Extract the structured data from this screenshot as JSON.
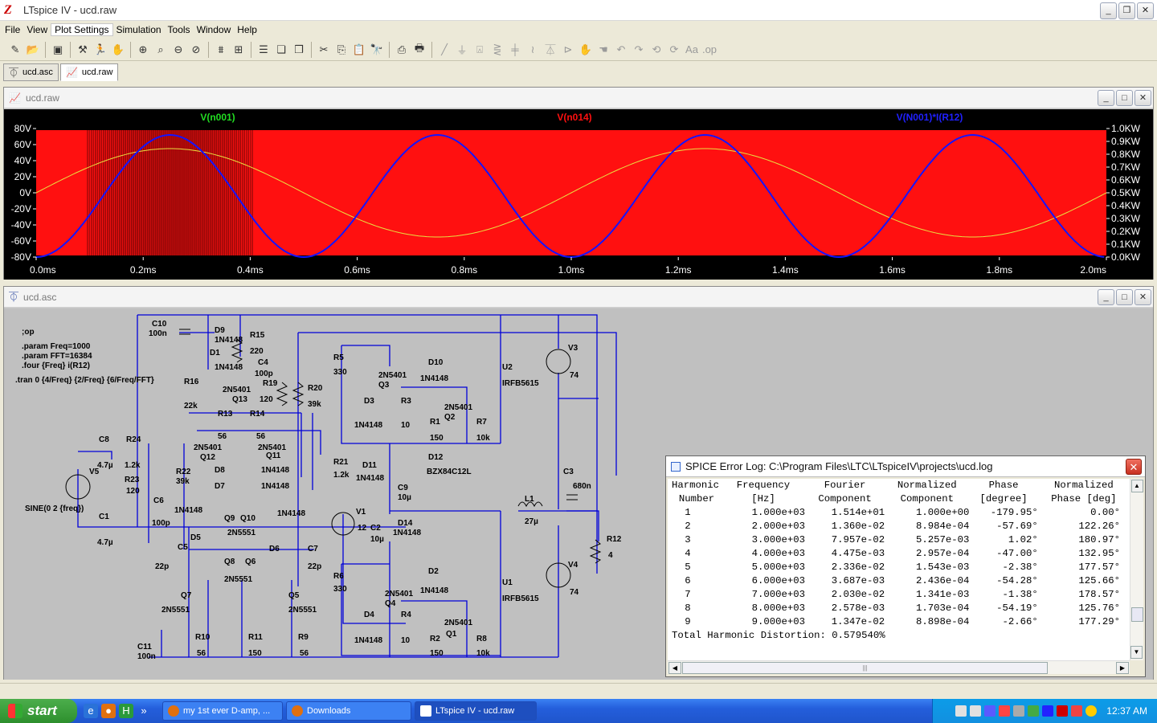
{
  "window": {
    "title": "LTspice IV - ucd.raw"
  },
  "menu": [
    "File",
    "View",
    "Plot Settings",
    "Simulation",
    "Tools",
    "Window",
    "Help"
  ],
  "tabs": [
    {
      "label": "ucd.asc"
    },
    {
      "label": "ucd.raw"
    }
  ],
  "plot_window": {
    "title": "ucd.raw",
    "traces": [
      {
        "label": "V(n001)",
        "color": "#22dd22"
      },
      {
        "label": "V(n014)",
        "color": "#ff1010"
      },
      {
        "label": "V(N001)*I(R12)",
        "color": "#2020ff"
      }
    ]
  },
  "chart_data": {
    "type": "line",
    "x": [
      0.0,
      0.25,
      0.5,
      0.75,
      1.0,
      1.25,
      1.5,
      1.75,
      2.0
    ],
    "series": [
      {
        "name": "V(n001)",
        "values": [
          0,
          55,
          0,
          -55,
          0,
          55,
          0,
          -55,
          0
        ]
      },
      {
        "name": "V(N001)*I(R12)",
        "values": [
          0,
          0.95,
          0,
          0.95,
          0,
          0.95,
          0,
          0.95,
          0
        ]
      }
    ],
    "xlim": [
      0,
      2.0
    ],
    "ylim_left": [
      -80,
      80
    ],
    "ylim_right": [
      0,
      1.0
    ],
    "xticks": [
      "0.0ms",
      "0.2ms",
      "0.4ms",
      "0.6ms",
      "0.8ms",
      "1.0ms",
      "1.2ms",
      "1.4ms",
      "1.6ms",
      "1.8ms",
      "2.0ms"
    ],
    "yticks_left": [
      "80V",
      "60V",
      "40V",
      "20V",
      "0V",
      "-20V",
      "-40V",
      "-60V",
      "-80V"
    ],
    "yticks_right": [
      "1.0KW",
      "0.9KW",
      "0.8KW",
      "0.7KW",
      "0.6KW",
      "0.5KW",
      "0.4KW",
      "0.3KW",
      "0.2KW",
      "0.1KW",
      "0.0KW"
    ]
  },
  "schematic_window": {
    "title": "ucd.asc",
    "directives": [
      ";op",
      ".param Freq=1000",
      ".param FFT=16384",
      ".four {Freq} i(R12)",
      ".tran 0 {4/Freq} {2/Freq} {6/Freq/FFT}"
    ],
    "labels": {
      "C10": "C10",
      "c10v": "100n",
      "D9": "D9",
      "d9v": "1N4148",
      "R15": "R15",
      "r15v": "220",
      "D1": "D1",
      "d1v": "1N4148",
      "C4": "C4",
      "c4v": "100p",
      "R19": "R19",
      "r19v": "120",
      "R20": "R20",
      "r20v": "39k",
      "R16": "R16",
      "r16v": "22k",
      "Q13": "Q13",
      "q13v": "2N5401",
      "R13": "R13",
      "r13v": "56",
      "R14": "R14",
      "r14v": "56",
      "Q12": "Q12",
      "q12v": "2N5401",
      "Q11": "Q11",
      "q11v": "2N5401",
      "C8": "C8",
      "c8v": "4.7µ",
      "R24": "R24",
      "r24v": "1.2k",
      "V5": "V5",
      "v5v": "SINE(0 2 {freq})",
      "R23": "R23",
      "r23v": "120",
      "R22": "R22",
      "r22v": "39k",
      "C6": "C6",
      "c6v": "100p",
      "D8": "D8",
      "D7": "D7",
      "d8v": "1N4148",
      "d7v": "1N4148",
      "C1": "C1",
      "c1v": "4.7µ",
      "R21": "R21",
      "r21v": "1.2k",
      "R5": "R5",
      "r5v": "330",
      "Q3": "Q3",
      "q3v": "2N5401",
      "D10": "D10",
      "d10v": "1N4148",
      "U2": "U2",
      "u2v": "IRFB5615",
      "V3": "V3",
      "v3v": "74",
      "D3": "D3",
      "d3v": "1N4148",
      "R3": "R3",
      "r3v": "10",
      "R1": "R1",
      "r1v": "150",
      "Q2": "Q2",
      "q2v": "2N5401",
      "R7": "R7",
      "r7v": "10k",
      "D11": "D11",
      "d11v": "1N4148",
      "D12": "D12",
      "d12v": "BZX84C12L",
      "C9": "C9",
      "c9v": "10µ",
      "C3": "C3",
      "c3v": "680n",
      "L1": "L1",
      "l1v": "27µ",
      "V1": "V1",
      "v1v": "12",
      "D14": "D14",
      "d14v": "1N4148",
      "C2": "C2",
      "c2v": "10µ",
      "R12": "R12",
      "r12v": "4",
      "V4": "V4",
      "v4v": "74",
      "U1": "U1",
      "u1v": "IRFB5615",
      "D2": "D2",
      "d2v": "1N4148",
      "R6": "R6",
      "r6v": "330",
      "Q4": "Q4",
      "q4v": "2N5401",
      "D4": "D4",
      "d4v": "1N4148",
      "R4": "R4",
      "r4v": "10",
      "Q1": "Q1",
      "q1v": "2N5401",
      "R2": "R2",
      "r2v": "150",
      "R8": "R8",
      "r8v": "10k",
      "Q9": "Q9",
      "Q10": "Q10",
      "q910v": "2N5551",
      "D5": "D5",
      "d5v": "1N4148",
      "D6": "D6",
      "d6v": "1N4148",
      "C5": "C5",
      "c5v": "22p",
      "C7": "C7",
      "c7v": "22p",
      "Q8": "Q8",
      "Q6": "Q6",
      "q86v": "2N5551",
      "Q7": "Q7",
      "q7v": "2N5551",
      "Q5": "Q5",
      "q5v": "2N5551",
      "R10": "R10",
      "r10v": "56",
      "R11": "R11",
      "r11v": "150",
      "R9": "R9",
      "r9v": "56",
      "C11": "C11",
      "c11v": "100n"
    }
  },
  "log_window": {
    "title": "SPICE Error Log: C:\\Program Files\\LTC\\LTspiceIV\\projects\\ucd.log",
    "header1": [
      "Harmonic",
      "Frequency",
      "Fourier",
      "Normalized",
      "Phase",
      "Normalized"
    ],
    "header2": [
      "Number",
      "[Hz]",
      "Component",
      "Component",
      "[degree]",
      "Phase [deg]"
    ],
    "rows": [
      [
        "1",
        "1.000e+03",
        "1.514e+01",
        "1.000e+00",
        "-179.95°",
        "0.00°"
      ],
      [
        "2",
        "2.000e+03",
        "1.360e-02",
        "8.984e-04",
        "-57.69°",
        "122.26°"
      ],
      [
        "3",
        "3.000e+03",
        "7.957e-02",
        "5.257e-03",
        "1.02°",
        "180.97°"
      ],
      [
        "4",
        "4.000e+03",
        "4.475e-03",
        "2.957e-04",
        "-47.00°",
        "132.95°"
      ],
      [
        "5",
        "5.000e+03",
        "2.336e-02",
        "1.543e-03",
        "-2.38°",
        "177.57°"
      ],
      [
        "6",
        "6.000e+03",
        "3.687e-03",
        "2.436e-04",
        "-54.28°",
        "125.66°"
      ],
      [
        "7",
        "7.000e+03",
        "2.030e-02",
        "1.341e-03",
        "-1.38°",
        "178.57°"
      ],
      [
        "8",
        "8.000e+03",
        "2.578e-03",
        "1.703e-04",
        "-54.19°",
        "125.76°"
      ],
      [
        "9",
        "9.000e+03",
        "1.347e-02",
        "8.898e-04",
        "-2.66°",
        "177.29°"
      ]
    ],
    "thd": "Total Harmonic Distortion: 0.579540%"
  },
  "taskbar": {
    "start": "start",
    "buttons": [
      "my 1st ever D-amp, ...",
      "Downloads",
      "LTspice IV - ucd.raw"
    ],
    "clock": "12:37 AM"
  }
}
